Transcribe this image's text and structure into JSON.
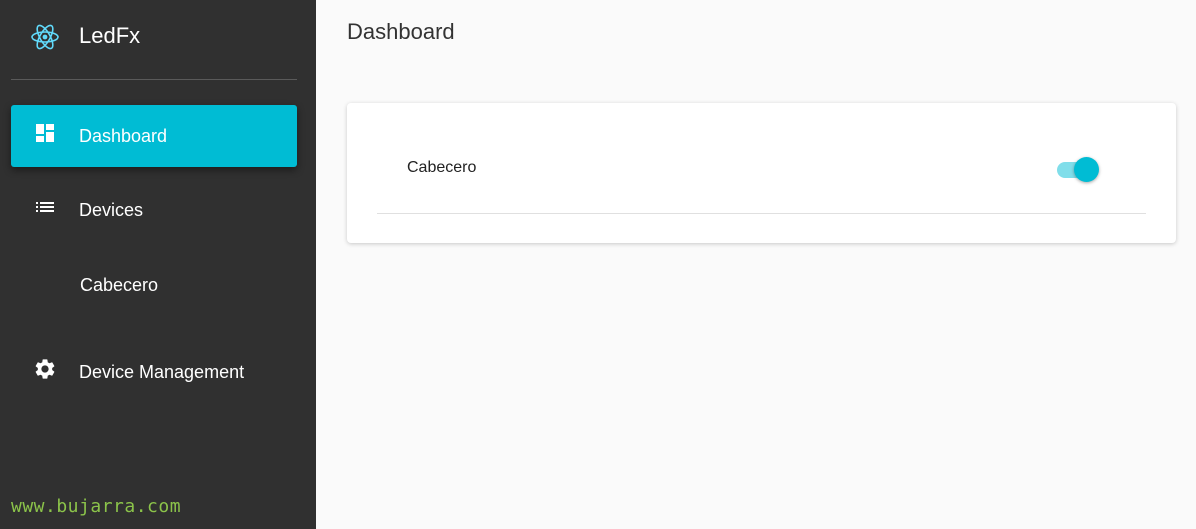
{
  "app": {
    "name": "LedFx",
    "logo_icon": "atom-icon"
  },
  "sidebar": {
    "items": [
      {
        "label": "Dashboard",
        "icon": "dashboard-icon",
        "active": true
      },
      {
        "label": "Devices",
        "icon": "list-icon",
        "active": false
      },
      {
        "label": "Cabecero",
        "icon": null,
        "active": false
      },
      {
        "label": "Device Management",
        "icon": "gear-icon",
        "active": false
      }
    ]
  },
  "watermark": "www.bujarra.com",
  "main": {
    "title": "Dashboard",
    "devices": [
      {
        "name": "Cabecero",
        "enabled": true
      }
    ]
  },
  "colors": {
    "accent": "#00bcd4",
    "sidebar_bg": "#303030",
    "toggle_track": "#80deea",
    "watermark": "#8bc34a"
  }
}
